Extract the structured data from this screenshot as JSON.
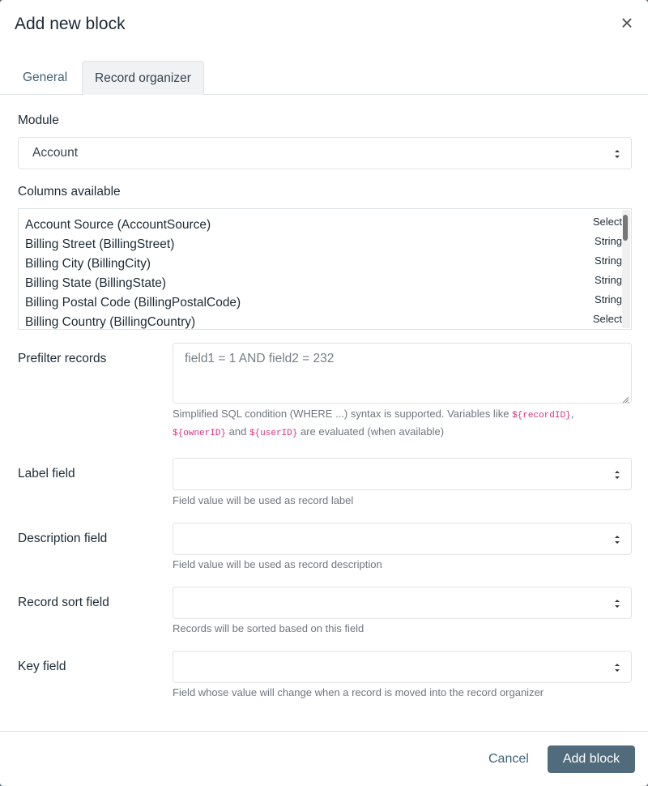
{
  "modal": {
    "title": "Add new block",
    "close_icon": "×"
  },
  "tabs": [
    {
      "label": "General",
      "active": false
    },
    {
      "label": "Record organizer",
      "active": true
    }
  ],
  "module": {
    "label": "Module",
    "value": "Account"
  },
  "columns": {
    "label": "Columns available",
    "items": [
      {
        "name": "Account Source (AccountSource)",
        "type": "Select"
      },
      {
        "name": "Billing Street (BillingStreet)",
        "type": "String"
      },
      {
        "name": "Billing City (BillingCity)",
        "type": "String"
      },
      {
        "name": "Billing State (BillingState)",
        "type": "String"
      },
      {
        "name": "Billing Postal Code (BillingPostalCode)",
        "type": "String"
      },
      {
        "name": "Billing Country (BillingCountry)",
        "type": "Select"
      }
    ]
  },
  "prefilter": {
    "label": "Prefilter records",
    "placeholder": "field1 = 1 AND field2 = 232",
    "help_1": "Simplified SQL condition (WHERE ...) syntax is supported. Variables like ",
    "code_record": "${recordID}",
    "help_2": ",",
    "code_owner": "${ownerID}",
    "help_3": " and ",
    "code_user": "${userID}",
    "help_4": " are evaluated (when available)"
  },
  "label_field": {
    "label": "Label field",
    "value": "",
    "help": "Field value will be used as record label"
  },
  "description_field": {
    "label": "Description field",
    "value": "",
    "help": "Field value will be used as record description"
  },
  "sort_field": {
    "label": "Record sort field",
    "value": "",
    "help": "Records will be sorted based on this field"
  },
  "key_field": {
    "label": "Key field",
    "value": "",
    "help": "Field whose value will change when a record is moved into the record organizer"
  },
  "footer": {
    "cancel_label": "Cancel",
    "add_label": "Add block"
  },
  "colors": {
    "primary": "#506c7c",
    "link": "#41627a",
    "code": "#d63384"
  }
}
